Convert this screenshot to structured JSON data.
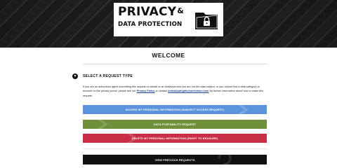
{
  "header": {
    "logo_line1": "PRIVACY",
    "logo_amp": "&",
    "logo_line2": "DATA PROTECTION",
    "logo_icon": "folder-lock-icon"
  },
  "page": {
    "title": "WELCOME"
  },
  "section": {
    "bullet": "▼",
    "title": "SELECT A REQUEST TYPE",
    "notice_part1": "If you are an authorized agent submitting this request on behalf of an individual and you are not the data subject, or you cannot find a data category or account on the privacy portal, please see our ",
    "privacy_policy_link": "Privacy Policy",
    "notice_part2": " or contact ",
    "email_link": "individualrights@activision.com",
    "notice_part3": " for further information about how to make this request."
  },
  "buttons": {
    "access": "ACCESS MY PERSONAL INFORMATION (SUBJECT ACCESS REQUEST)",
    "portability": "DATA PORTABILITY REQUEST",
    "delete": "DELETE MY PERSONAL INFORMATION (RIGHT TO ERASURE)",
    "view_previous": "VIEW PREVIOUS REQUESTS"
  },
  "colors": {
    "access": "#5b93dd",
    "portability": "#6f8f3b",
    "delete": "#c82e45",
    "view_previous": "#111111"
  }
}
